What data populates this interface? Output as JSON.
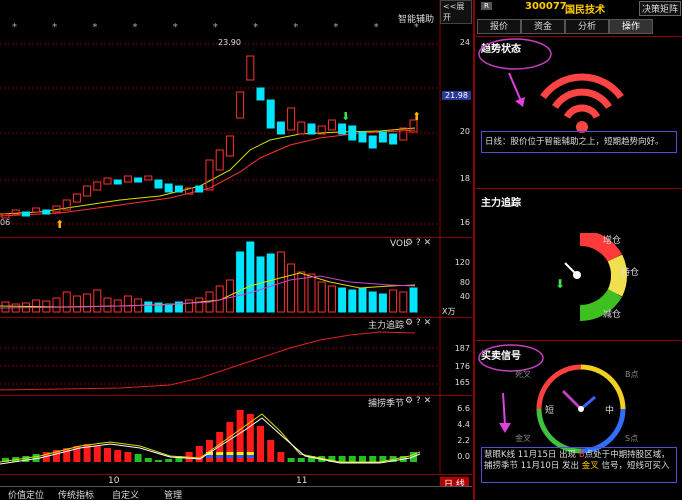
{
  "header": {
    "collapse_label": "<<展开",
    "smart_label": "智能辅助"
  },
  "main_chart": {
    "price_axis": [
      "24",
      "22",
      "20",
      "18",
      "16"
    ],
    "current_price": "21.98",
    "high_label": "23.90",
    "low_label": "06",
    "stars": "* * * * * * * * * * * *"
  },
  "vol": {
    "title": "VOL",
    "axis": [
      "120",
      "80",
      "40"
    ],
    "unit": "X万"
  },
  "zlzz": {
    "title": "主力追踪",
    "axis": [
      "187",
      "176",
      "165"
    ]
  },
  "bljj": {
    "title": "捕捞季节",
    "axis": [
      "6.6",
      "4.4",
      "2.2",
      "0.0"
    ]
  },
  "xaxis": {
    "labels": [
      "10",
      "11"
    ]
  },
  "bottom_tabs": [
    "价值定位",
    "传统指标",
    "自定义",
    "管理"
  ],
  "dayline": "日 线",
  "right": {
    "badge": "R",
    "code": "300077",
    "name": "国民技术",
    "matrix": "决策矩阵",
    "tabs": [
      "报价",
      "资金",
      "分析",
      "操作"
    ],
    "trend_title": "趋势状态",
    "trend_text": "日线：股价位于智能辅助之上，短期趋势向好。",
    "main_title": "主力追踪",
    "gauge_labels": [
      "增仓",
      "持仓",
      "减仓"
    ],
    "signal_title": "买卖信号",
    "clock_labels": [
      "死叉",
      "短",
      "B点",
      "中",
      "S点",
      "金叉"
    ],
    "signal_prefix": "慧眼K线 11月15日 出现 ",
    "signal_b": "B",
    "signal_mid": "点处于中期持股区域，捕捞季节 11月10日 发出 ",
    "signal_gold": "金叉",
    "signal_suffix": " 信号，短线可买入"
  }
}
